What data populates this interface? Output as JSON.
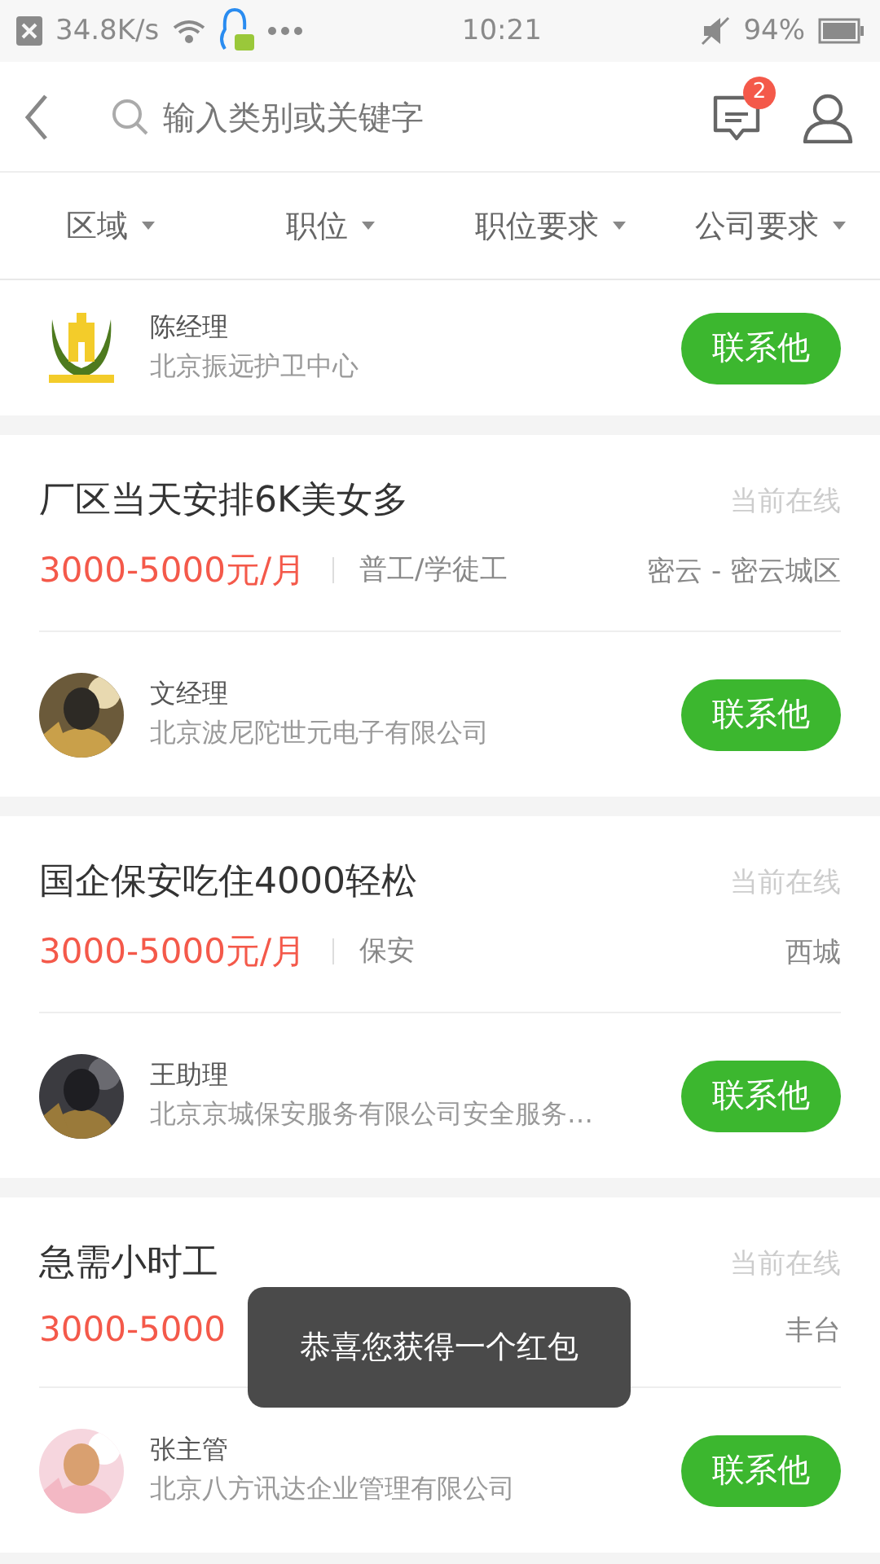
{
  "status_bar": {
    "speed": "34.8K/s",
    "time": "10:21",
    "battery": "94%"
  },
  "header": {
    "search": {
      "placeholder": "输入类别或关键字"
    },
    "messages_badge": "2"
  },
  "filters": [
    {
      "label": "区域"
    },
    {
      "label": "职位"
    },
    {
      "label": "职位要求"
    },
    {
      "label": "公司要求"
    }
  ],
  "cards": [
    {
      "contact": {
        "avatar": {
          "kind": "logo"
        },
        "name": "陈经理",
        "company": "北京振远护卫中心",
        "button": "联系他"
      }
    },
    {
      "job": {
        "title": "厂区当天安排6K美女多",
        "status": "当前在线",
        "salary": "3000-5000元/月",
        "category": "普工/学徒工",
        "location": "密云 - 密云城区"
      },
      "contact": {
        "name": "文经理",
        "company": "北京波尼陀世元电子有限公司",
        "button": "联系他"
      }
    },
    {
      "job": {
        "title": "国企保安吃住4000轻松",
        "status": "当前在线",
        "salary": "3000-5000元/月",
        "category": "保安",
        "location": "西城"
      },
      "contact": {
        "name": "王助理",
        "company": "北京京城保安服务有限公司安全服务…",
        "button": "联系他"
      }
    },
    {
      "job": {
        "title": "急需小时工",
        "status": "当前在线",
        "salary": "3000-5000",
        "location": "丰台"
      },
      "contact": {
        "name": "张主管",
        "company": "北京八方讯达企业管理有限公司",
        "button": "联系他"
      }
    }
  ],
  "toast": "恭喜您获得一个红包"
}
